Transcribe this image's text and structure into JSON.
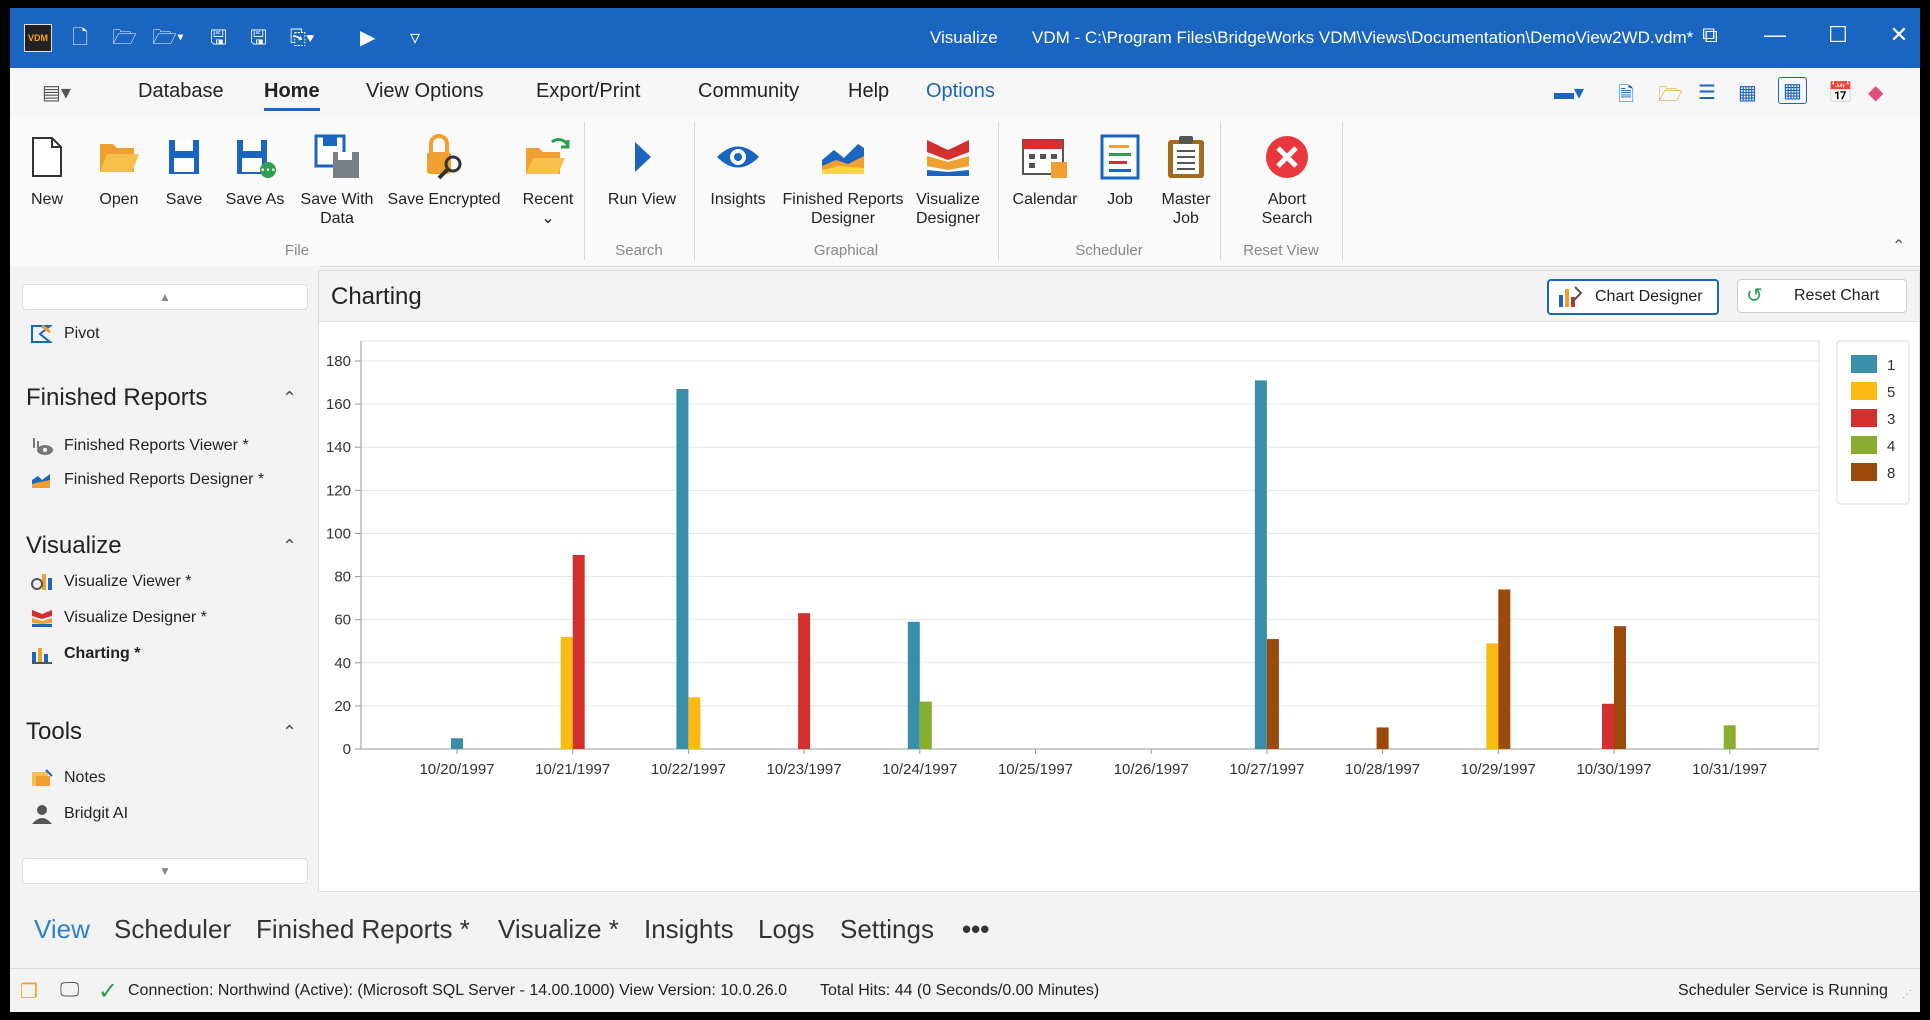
{
  "titlebar": {
    "app_name": "Visualize",
    "path": "VDM - C:\\Program Files\\BridgeWorks VDM\\Views\\Documentation\\DemoView2WD.vdm*",
    "logo_text": "VDM"
  },
  "menu": {
    "items": [
      "Database",
      "Home",
      "View Options",
      "Export/Print",
      "Community",
      "Help",
      "Options"
    ],
    "active": "Home"
  },
  "ribbon": {
    "buttons": {
      "new": "New",
      "open": "Open",
      "save": "Save",
      "save_as": "Save As",
      "save_with_data": "Save With Data",
      "save_encrypted": "Save Encrypted",
      "recent": "Recent",
      "run_view": "Run View",
      "insights": "Insights",
      "finished_reports_designer": "Finished Reports Designer",
      "visualize_designer": "Visualize Designer",
      "calendar": "Calendar",
      "job": "Job",
      "master_job": "Master Job",
      "abort_search": "Abort Search"
    },
    "groups": {
      "file": "File",
      "search": "Search",
      "graphical": "Graphical",
      "scheduler": "Scheduler",
      "reset_view": "Reset View"
    }
  },
  "leftpanel": {
    "pivot": "Pivot",
    "sections": {
      "finished_reports": {
        "title": "Finished Reports",
        "items": [
          "Finished Reports Viewer *",
          "Finished Reports Designer *"
        ]
      },
      "visualize": {
        "title": "Visualize",
        "items": [
          "Visualize Viewer *",
          "Visualize Designer *",
          "Charting *"
        ]
      },
      "tools": {
        "title": "Tools",
        "items": [
          "Notes",
          "Bridgit AI"
        ]
      }
    }
  },
  "main": {
    "title": "Charting",
    "chart_designer": "Chart Designer",
    "reset_chart": "Reset Chart"
  },
  "chart_data": {
    "type": "bar",
    "categories": [
      "10/20/1997",
      "10/21/1997",
      "10/22/1997",
      "10/23/1997",
      "10/24/1997",
      "10/25/1997",
      "10/26/1997",
      "10/27/1997",
      "10/28/1997",
      "10/29/1997",
      "10/30/1997",
      "10/31/1997"
    ],
    "series": [
      {
        "name": "1",
        "color": "#3a8fa8",
        "values": [
          5,
          0,
          167,
          0,
          59,
          0,
          0,
          171,
          0,
          0,
          0,
          0
        ]
      },
      {
        "name": "5",
        "color": "#fbb914",
        "values": [
          0,
          52,
          24,
          0,
          0,
          0,
          0,
          0,
          0,
          49,
          0,
          0
        ]
      },
      {
        "name": "3",
        "color": "#d2302f",
        "values": [
          0,
          90,
          0,
          63,
          0,
          0,
          0,
          0,
          0,
          0,
          21,
          0
        ]
      },
      {
        "name": "4",
        "color": "#8aad31",
        "values": [
          0,
          0,
          0,
          0,
          22,
          0,
          0,
          0,
          0,
          0,
          0,
          11
        ]
      },
      {
        "name": "8",
        "color": "#9b4a0b",
        "values": [
          0,
          0,
          0,
          0,
          0,
          0,
          0,
          51,
          10,
          74,
          57,
          0
        ]
      }
    ],
    "yticks": [
      "0",
      "20",
      "40",
      "60",
      "80",
      "100",
      "120",
      "140",
      "160",
      "180"
    ],
    "ylim": [
      0,
      180
    ],
    "grid": true,
    "legend_position": "top-right"
  },
  "tabs": {
    "items": [
      "View",
      "Scheduler",
      "Finished Reports *",
      "Visualize *",
      "Insights",
      "Logs",
      "Settings"
    ],
    "more": "•••",
    "active": "View"
  },
  "status": {
    "connection": "Connection: Northwind (Active): (Microsoft SQL Server - 14.00.1000) View Version: 10.0.26.0",
    "hits": "Total Hits: 44 (0 Seconds/0.00 Minutes)",
    "scheduler": "Scheduler Service is Running"
  }
}
